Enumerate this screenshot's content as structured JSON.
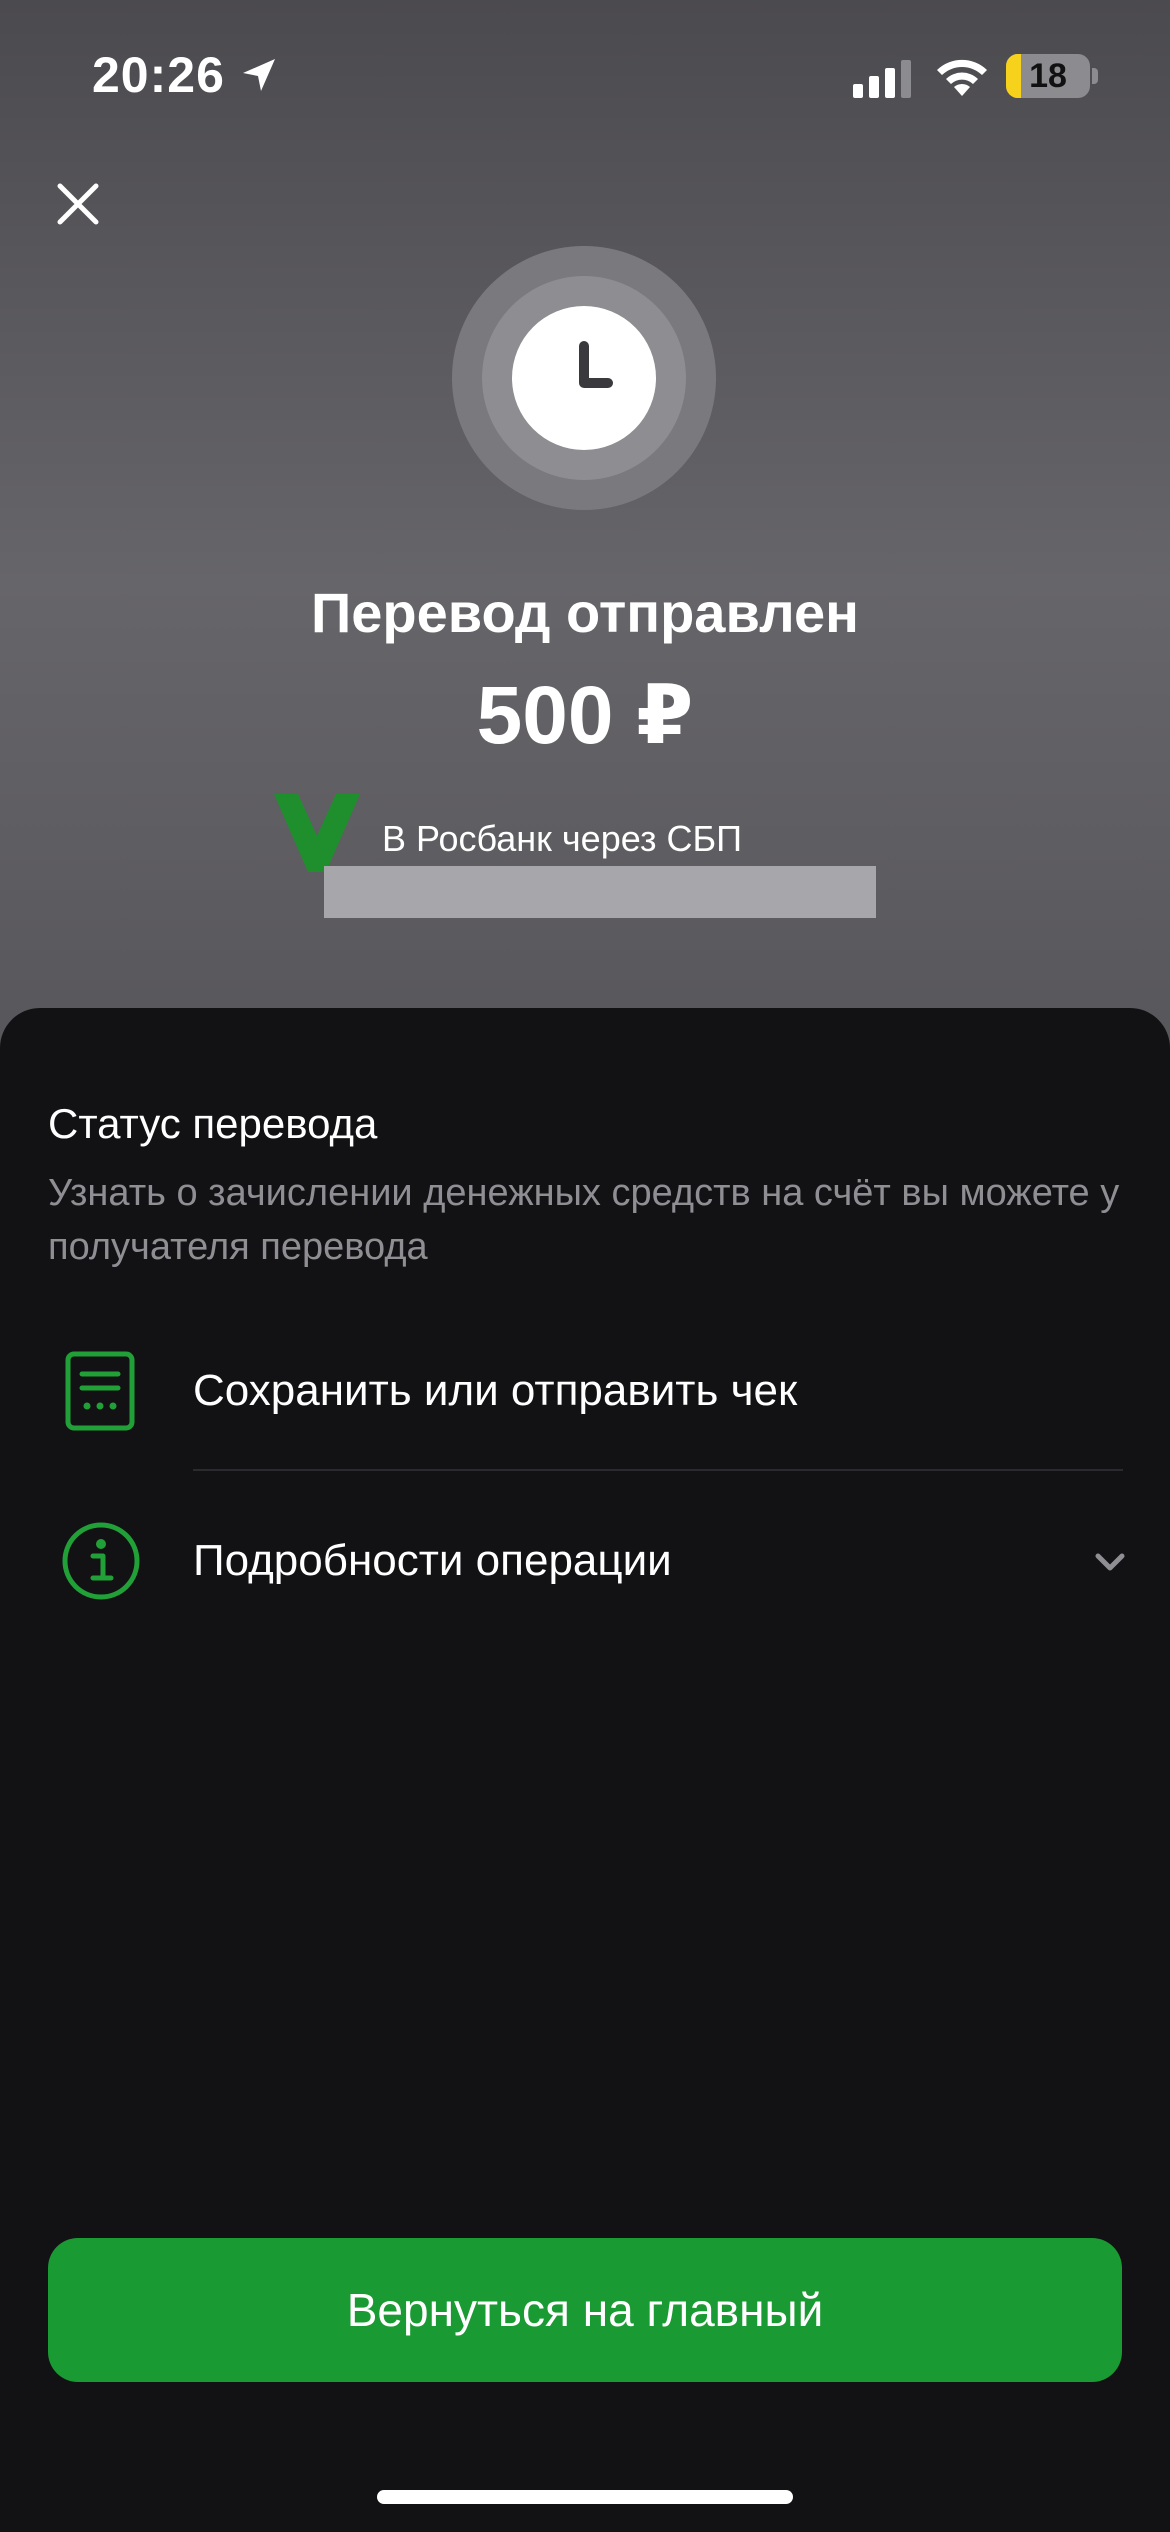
{
  "status_bar": {
    "time": "20:26",
    "battery_level": "18",
    "battery_fraction": 0.18,
    "battery_color": "#f7d21c"
  },
  "header": {
    "title": "Перевод отправлен",
    "amount": "500 ₽",
    "bank_line": "В Росбанк через СБП"
  },
  "sheet": {
    "status_title": "Статус перевода",
    "status_description": "Узнать о зачислении денежных средств на счёт вы можете у получателя перевода",
    "rows": [
      {
        "label": "Сохранить или отправить чек",
        "icon": "receipt-icon"
      },
      {
        "label": "Подробности операции",
        "icon": "info-icon"
      }
    ]
  },
  "actions": {
    "home_button": "Вернуться на главный"
  },
  "colors": {
    "accent_green": "#1a9a32",
    "icon_green": "#21a038",
    "sheet_background": "#121114"
  }
}
